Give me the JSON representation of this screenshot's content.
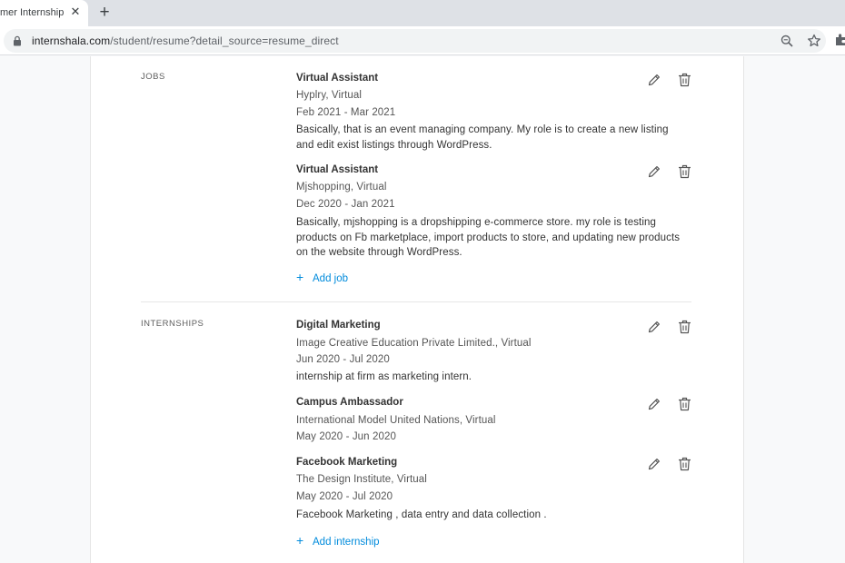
{
  "browser": {
    "tab_title": "mer Internship",
    "url_host": "internshala.com",
    "url_path": "/student/resume?detail_source=resume_direct"
  },
  "resume": {
    "jobs": {
      "label": "JOBS",
      "entries": [
        {
          "title": "Virtual Assistant",
          "company": "Hyplry, Virtual",
          "dates": "Feb 2021 - Mar 2021",
          "description": "Basically, that is an event managing company. My role is to create a new listing and edit exist listings through WordPress."
        },
        {
          "title": "Virtual Assistant",
          "company": "Mjshopping, Virtual",
          "dates": "Dec 2020 - Jan 2021",
          "description": "Basically, mjshopping is a dropshipping e-commerce store. my role is testing products on Fb marketplace, import products to store, and updating new products on the website through WordPress."
        }
      ],
      "add_label": "Add job"
    },
    "internships": {
      "label": "INTERNSHIPS",
      "entries": [
        {
          "title": "Digital Marketing",
          "company": "Image Creative Education Private Limited., Virtual",
          "dates": "Jun 2020 - Jul 2020",
          "description": "internship at firm as marketing intern."
        },
        {
          "title": "Campus Ambassador",
          "company": "International Model United Nations, Virtual",
          "dates": "May 2020 - Jun 2020",
          "description": ""
        },
        {
          "title": "Facebook Marketing",
          "company": "The Design Institute, Virtual",
          "dates": "May 2020 - Jul 2020",
          "description": "Facebook Marketing , data entry and data collection ."
        }
      ],
      "add_label": "Add internship"
    }
  },
  "colors": {
    "link": "#008bdc",
    "icon": "#555555"
  }
}
